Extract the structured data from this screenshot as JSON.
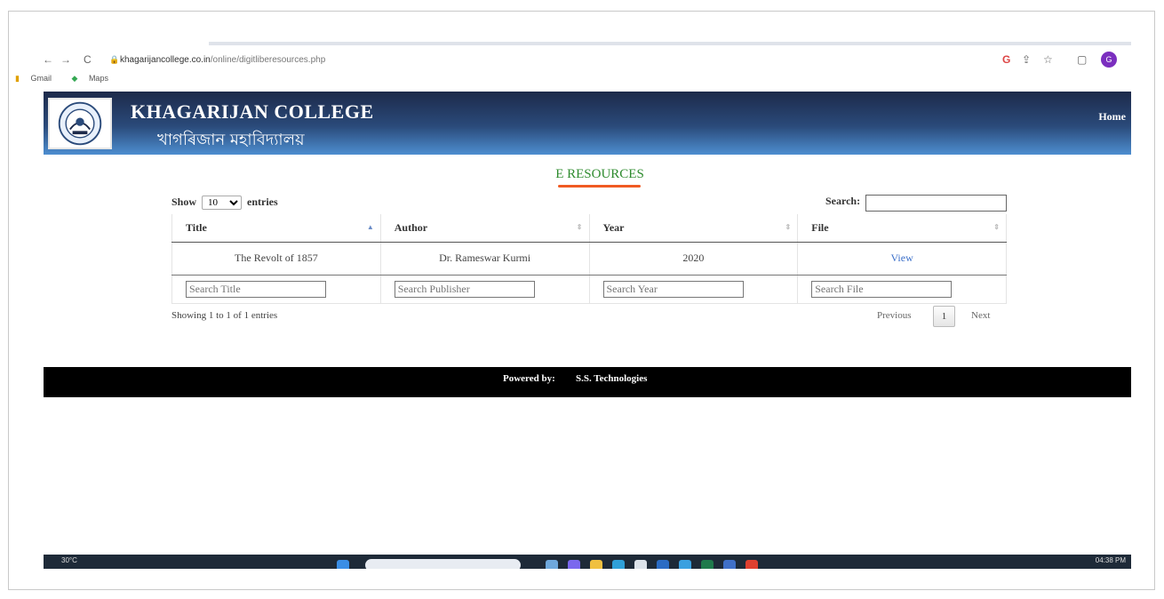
{
  "browser": {
    "url_host": "khagarijancollege.co.in",
    "url_path": "/online/digitliberesources.php",
    "nav_back": "←",
    "nav_forward": "→",
    "nav_reload": "C",
    "bookmarks": [
      "Gmail",
      "Maps"
    ],
    "avatar_letter": "G"
  },
  "header": {
    "college_name": "KHAGARIJAN COLLEGE",
    "college_name_bn": "খাগৰিজান মহাবিদ্যালয়",
    "nav_home": "Home",
    "gradient_top": "#1d2a4a",
    "gradient_bottom": "#4d8ed0"
  },
  "page": {
    "title": "E RESOURCES",
    "title_color": "#2e8b2e",
    "underline_color": "#f05a22"
  },
  "table_controls": {
    "show_label": "Show",
    "entries_label": "entries",
    "page_size": "10",
    "search_label": "Search:"
  },
  "table": {
    "columns": [
      "Title",
      "Author",
      "Year",
      "File"
    ],
    "rows": [
      {
        "title": "The Revolt of 1857",
        "author": "Dr. Rameswar Kurmi",
        "year": "2020",
        "file": "View"
      }
    ],
    "filters": {
      "title_placeholder": "Search Title",
      "author_placeholder": "Search Publisher",
      "year_placeholder": "Search Year",
      "file_placeholder": "Search File"
    }
  },
  "pagination": {
    "info": "Showing 1 to 1 of 1 entries",
    "previous": "Previous",
    "current_page": "1",
    "next": "Next"
  },
  "footer": {
    "powered_by": "Powered by:",
    "company": "S.S. Technologies"
  },
  "taskbar": {
    "temperature": "30°C",
    "time": "04:38 PM"
  }
}
